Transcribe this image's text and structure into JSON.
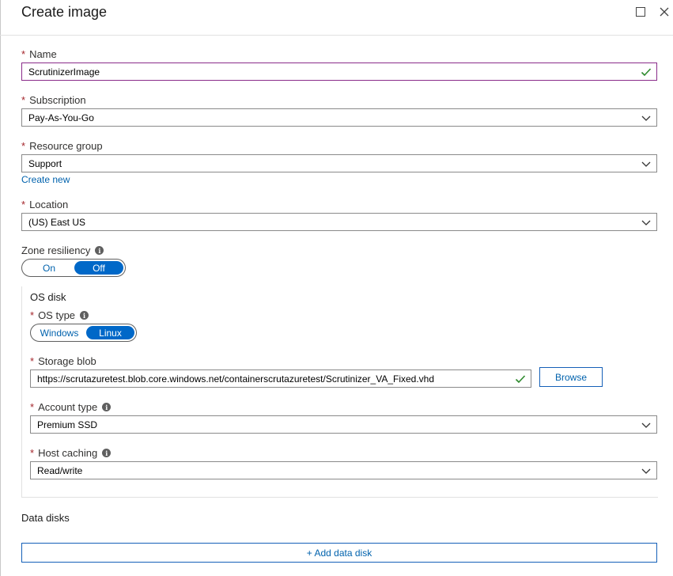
{
  "blade": {
    "title": "Create image"
  },
  "form": {
    "required_marker": "*",
    "name": {
      "label": "Name",
      "value": "ScrutinizerImage"
    },
    "subscription": {
      "label": "Subscription",
      "value": "Pay-As-You-Go"
    },
    "resource_group": {
      "label": "Resource group",
      "value": "Support",
      "create_new_label": "Create new"
    },
    "location": {
      "label": "Location",
      "value": "(US) East US"
    },
    "zone_resiliency": {
      "label": "Zone resiliency",
      "options": [
        "On",
        "Off"
      ],
      "selected": "Off"
    }
  },
  "os_disk": {
    "title": "OS disk",
    "os_type": {
      "label": "OS type",
      "options": [
        "Windows",
        "Linux"
      ],
      "selected": "Linux"
    },
    "storage_blob": {
      "label": "Storage blob",
      "value": "https://scrutazuretest.blob.core.windows.net/containerscrutazuretest/Scrutinizer_VA_Fixed.vhd",
      "browse_label": "Browse"
    },
    "account_type": {
      "label": "Account type",
      "value": "Premium SSD"
    },
    "host_caching": {
      "label": "Host caching",
      "value": "Read/write"
    }
  },
  "data_disks": {
    "title": "Data disks",
    "add_label": "+ Add data disk"
  },
  "icons": {
    "info": "i",
    "valid_color": "#2d8a2d",
    "accent": "#0068c8"
  }
}
